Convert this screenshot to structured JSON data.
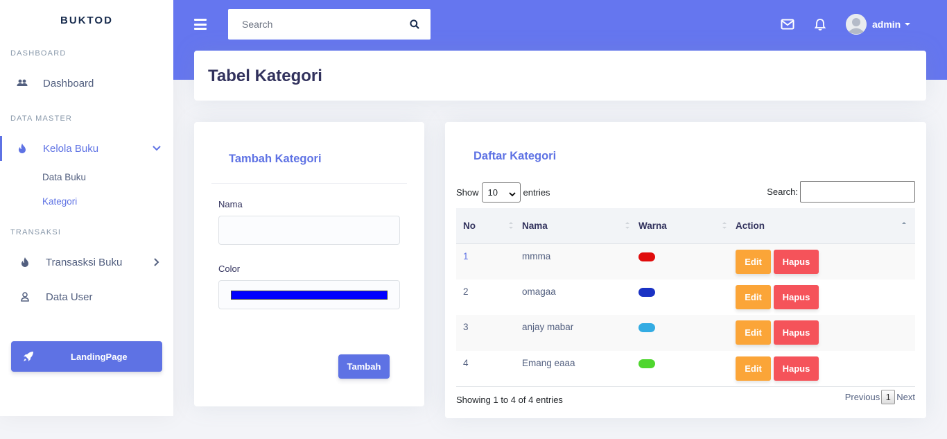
{
  "brand": "BUKTOD",
  "sidebar": {
    "sections": [
      {
        "heading": "DASHBOARD"
      },
      {
        "heading": "DATA MASTER"
      },
      {
        "heading": "TRANSAKSI"
      }
    ],
    "items": {
      "dashboard": "Dashboard",
      "kelola_buku": "Kelola Buku",
      "data_buku": "Data Buku",
      "kategori": "Kategori",
      "transaksi_buku": "Transasksi Buku",
      "data_user": "Data User"
    },
    "landing_button": "LandingPage"
  },
  "topbar": {
    "search_placeholder": "Search",
    "user_name": "admin"
  },
  "page_title": "Tabel Kategori",
  "form": {
    "title": "Tambah Kategori",
    "nama_label": "Nama",
    "nama_value": "",
    "color_label": "Color",
    "color_value": "#0000ff",
    "submit_label": "Tambah"
  },
  "list": {
    "title": "Daftar Kategori",
    "show_label": "Show",
    "entries_value": "10",
    "entries_label": "entries",
    "search_label": "Search:",
    "columns": [
      "No",
      "Nama",
      "Warna",
      "Action"
    ],
    "rows": [
      {
        "no": "1",
        "nama": "mmma",
        "warna": "#e00c0c"
      },
      {
        "no": "2",
        "nama": "omagaa",
        "warna": "#1a32c4"
      },
      {
        "no": "3",
        "nama": "anjay mabar",
        "warna": "#34ace3"
      },
      {
        "no": "4",
        "nama": "Emang eaaa",
        "warna": "#4fd62e"
      }
    ],
    "edit_label": "Edit",
    "hapus_label": "Hapus",
    "info": "Showing 1 to 4 of 4 entries",
    "pager": {
      "previous": "Previous",
      "page": "1",
      "next": "Next"
    }
  },
  "colors": {
    "accent": "#5e72e4",
    "topbar": "#6576ef",
    "edit": "#fba538",
    "hapus": "#f5535a"
  }
}
